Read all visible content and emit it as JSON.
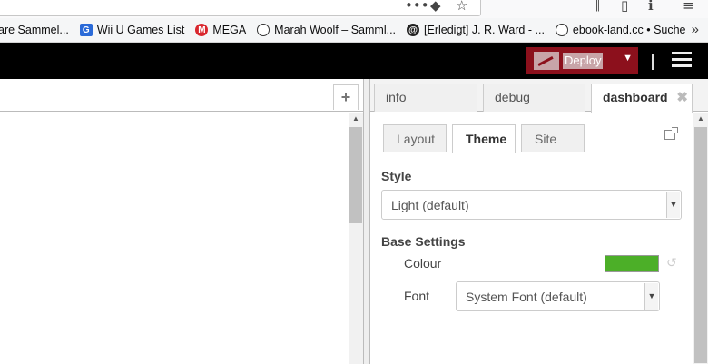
{
  "bookmarks": [
    {
      "label": "are Sammel...",
      "icon": "none",
      "color": ""
    },
    {
      "label": "Wii U Games List",
      "icon": "g-logo-icon",
      "color": "#2a6ad8"
    },
    {
      "label": "MEGA",
      "icon": "mega-icon",
      "color": "#d9272e"
    },
    {
      "label": "Marah Woolf – Samml...",
      "icon": "globe-icon",
      "color": "#333333"
    },
    {
      "label": "[Erledigt] J. R. Ward - ...",
      "icon": "forum-icon",
      "color": "#222222"
    },
    {
      "label": "ebook-land.cc • Suche",
      "icon": "globe-icon",
      "color": "#333333"
    }
  ],
  "header": {
    "deploy_label": "Deploy",
    "accent": "#8c101c"
  },
  "workspace": {
    "add_tab_label": "+"
  },
  "sidebar": {
    "tabs": [
      {
        "label": "info"
      },
      {
        "label": "debug"
      },
      {
        "label": "dashboard"
      }
    ],
    "active_tab": "dashboard",
    "close_label": "✖"
  },
  "dashboard": {
    "tabs": [
      {
        "label": "Layout"
      },
      {
        "label": "Theme"
      },
      {
        "label": "Site"
      }
    ],
    "active_tab": "Theme",
    "style_heading": "Style",
    "style_value": "Light (default)",
    "base_heading": "Base Settings",
    "colour_label": "Colour",
    "colour_value": "#4caf28",
    "font_label": "Font",
    "font_value": "System Font (default)"
  }
}
